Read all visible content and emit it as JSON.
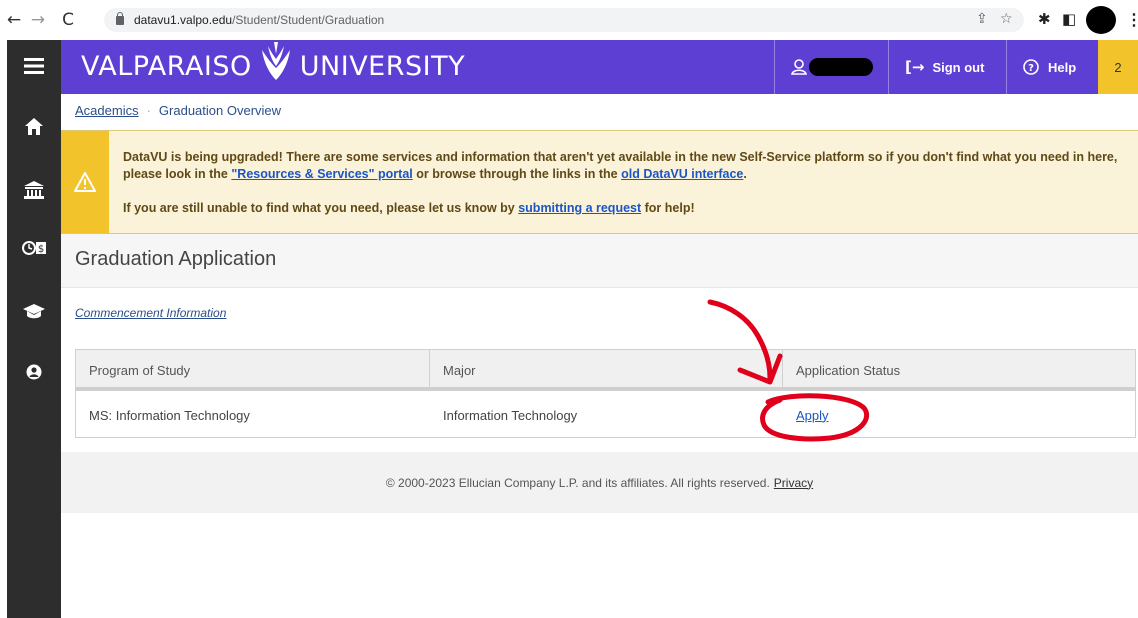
{
  "browser": {
    "url_host": "datavu1.valpo.edu",
    "url_path": "/Student/Student/Graduation"
  },
  "header": {
    "logo_left": "VALPARAISO",
    "logo_right": "UNIVERSITY",
    "sign_out": "Sign out",
    "help": "Help",
    "notification_count": "2",
    "colors": {
      "header_bg": "#5d3fd3",
      "accent": "#f3c32b",
      "sidebar": "#2d2d2d"
    }
  },
  "breadcrumb": {
    "root": "Academics",
    "separator": "·",
    "current": "Graduation Overview"
  },
  "banner": {
    "line1_pre": "DataVU is being upgraded! There are some services and information that aren't yet available in the new Self-Service platform so if you don't find what you need in here, please look in the ",
    "link1": "\"Resources & Services\" portal",
    "line1_mid": " or browse through the links in the ",
    "link2": "old DataVU interface",
    "line1_end": ".",
    "line2_pre": "If you are still unable to find what you need, please let us know by ",
    "link3": "submitting a request",
    "line2_end": " for help!"
  },
  "page": {
    "title": "Graduation Application",
    "commencement_link": "Commencement Information"
  },
  "table": {
    "headers": [
      "Program of Study",
      "Major",
      "Application Status"
    ],
    "rows": [
      {
        "program": "MS: Information Technology",
        "major": "Information Technology",
        "status_link": "Apply"
      }
    ]
  },
  "footer": {
    "text": "© 2000-2023 Ellucian Company L.P. and its affiliates. All rights reserved.",
    "privacy": "Privacy"
  },
  "sidebar": {
    "icons": [
      "menu-icon",
      "home-icon",
      "bank-icon",
      "finance-icon",
      "graduation-cap-icon",
      "user-circle-icon"
    ]
  }
}
